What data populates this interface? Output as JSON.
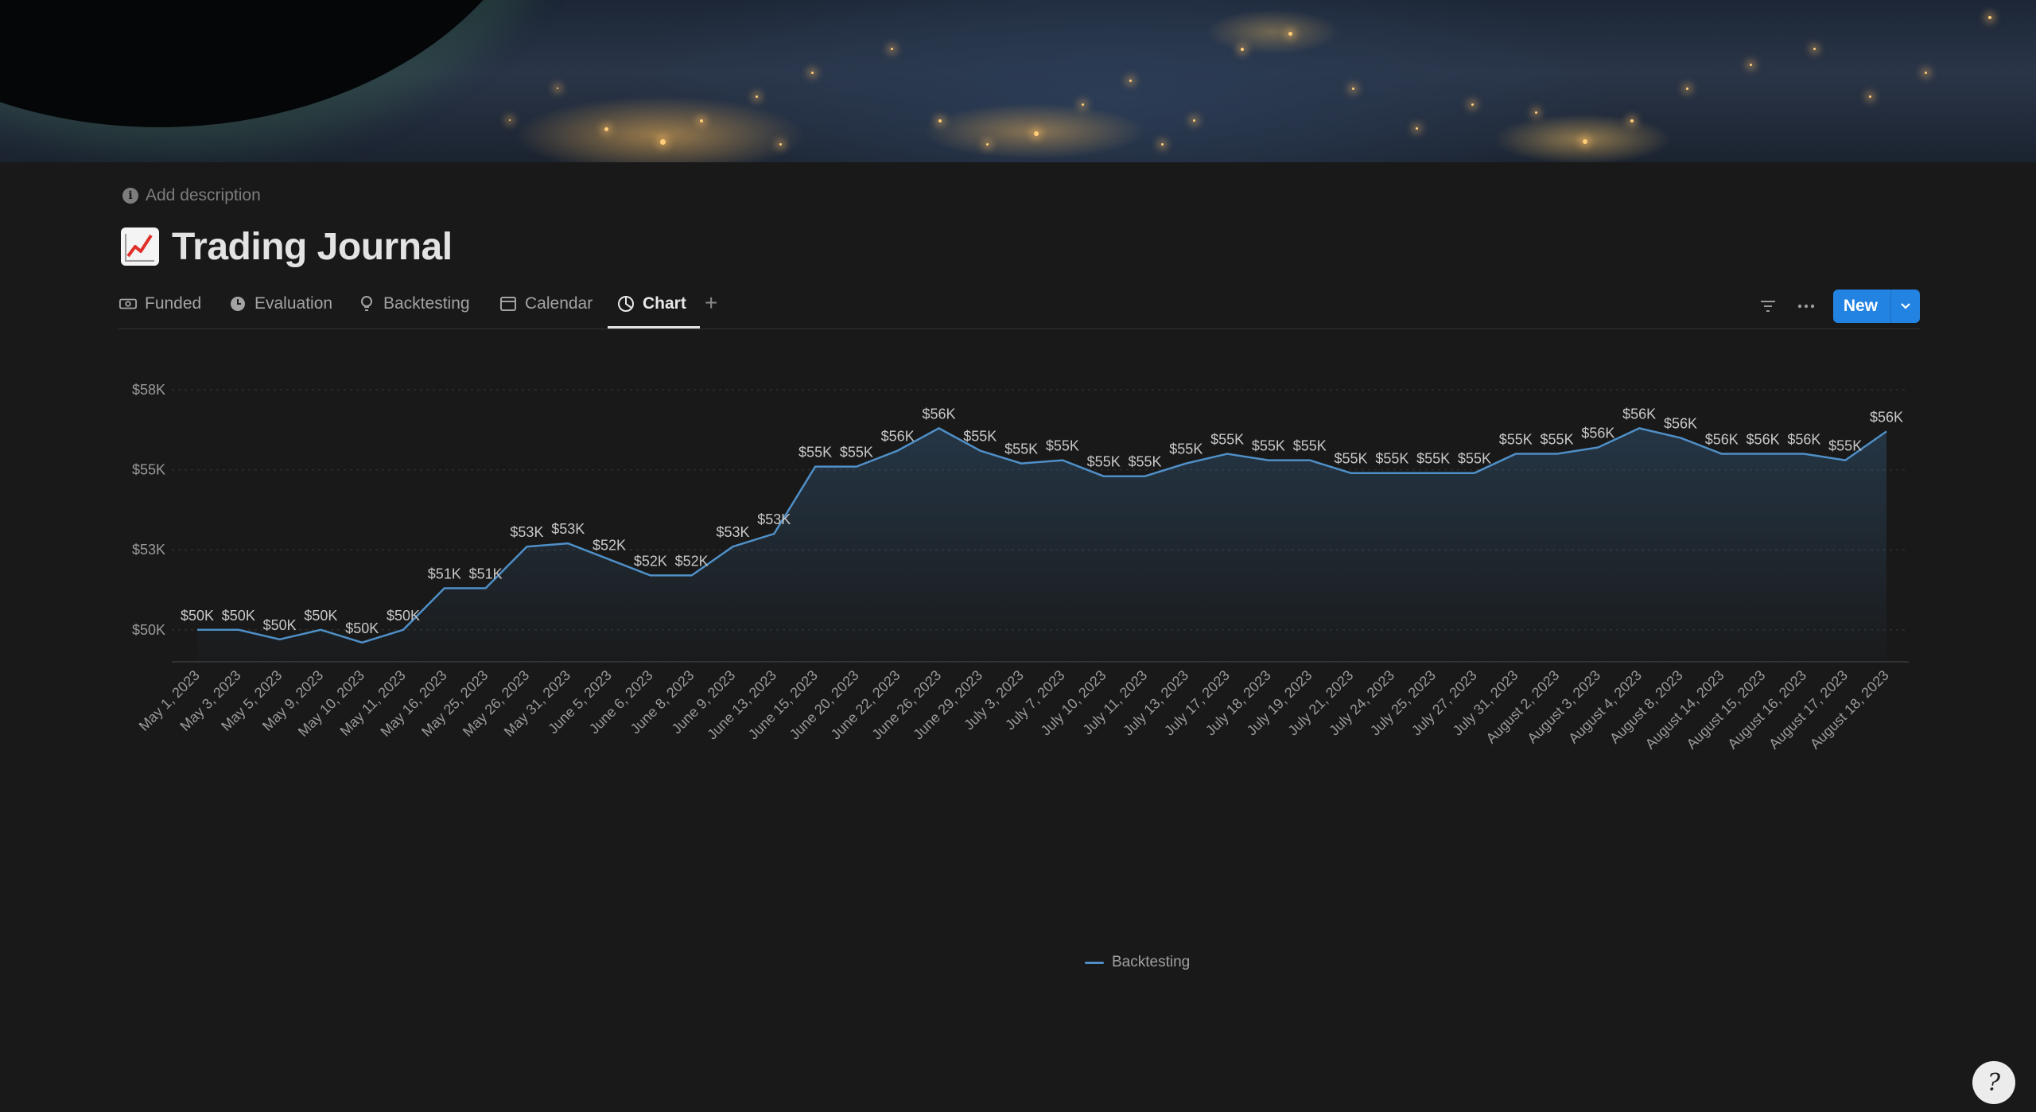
{
  "page": {
    "add_description": "Add description",
    "title": "Trading Journal",
    "title_icon": "chart-increasing-emoji"
  },
  "tabs": [
    {
      "label": "Funded",
      "icon": "money-icon"
    },
    {
      "label": "Evaluation",
      "icon": "clock-icon"
    },
    {
      "label": "Backtesting",
      "icon": "lightbulb-icon"
    },
    {
      "label": "Calendar",
      "icon": "calendar-icon"
    },
    {
      "label": "Chart",
      "icon": "chart-icon",
      "active": true
    }
  ],
  "toolbar": {
    "add_tab": "+",
    "new_label": "New"
  },
  "colors": {
    "background": "#191919",
    "accent": "#2383e2",
    "series_line": "#4f8fc7"
  },
  "chart_data": {
    "type": "area",
    "x": [
      "May 1, 2023",
      "May 3, 2023",
      "May 5, 2023",
      "May 9, 2023",
      "May 10, 2023",
      "May 11, 2023",
      "May 16, 2023",
      "May 25, 2023",
      "May 26, 2023",
      "May 31, 2023",
      "June 5, 2023",
      "June 6, 2023",
      "June 8, 2023",
      "June 9, 2023",
      "June 13, 2023",
      "June 15, 2023",
      "June 20, 2023",
      "June 22, 2023",
      "June 26, 2023",
      "June 29, 2023",
      "July 3, 2023",
      "July 7, 2023",
      "July 10, 2023",
      "July 11, 2023",
      "July 13, 2023",
      "July 17, 2023",
      "July 18, 2023",
      "July 19, 2023",
      "July 21, 2023",
      "July 24, 2023",
      "July 25, 2023",
      "July 27, 2023",
      "July 31, 2023",
      "August 2, 2023",
      "August 3, 2023",
      "August 4, 2023",
      "August 8, 2023",
      "August 14, 2023",
      "August 15, 2023",
      "August 16, 2023",
      "August 17, 2023",
      "August 18, 2023"
    ],
    "series": [
      {
        "name": "Backtesting",
        "values": [
          50000,
          50000,
          49700,
          50000,
          49600,
          50000,
          51300,
          51300,
          52600,
          52700,
          52200,
          51700,
          51700,
          52600,
          53000,
          55100,
          55100,
          55600,
          56300,
          55600,
          55200,
          55300,
          54800,
          54800,
          55200,
          55500,
          55300,
          55300,
          54900,
          54900,
          54900,
          54900,
          55500,
          55500,
          55700,
          56300,
          56000,
          55500,
          55500,
          55500,
          55300,
          56200
        ],
        "labels": [
          "$50K",
          "$50K",
          "$50K",
          "$50K",
          "$50K",
          "$50K",
          "$51K",
          "$51K",
          "$53K",
          "$53K",
          "$52K",
          "$52K",
          "$52K",
          "$53K",
          "$53K",
          "$55K",
          "$55K",
          "$56K",
          "$56K",
          "$55K",
          "$55K",
          "$55K",
          "$55K",
          "$55K",
          "$55K",
          "$55K",
          "$55K",
          "$55K",
          "$55K",
          "$55K",
          "$55K",
          "$55K",
          "$55K",
          "$55K",
          "$56K",
          "$56K",
          "$56K",
          "$56K",
          "$56K",
          "$56K",
          "$55K",
          "$56K"
        ]
      }
    ],
    "y_ticks": [
      {
        "value": 50000,
        "label": "$50K"
      },
      {
        "value": 52500,
        "label": "$53K"
      },
      {
        "value": 55000,
        "label": "$55K"
      },
      {
        "value": 57500,
        "label": "$58K"
      }
    ],
    "ylim": [
      49000,
      58000
    ],
    "grid": true,
    "legend": "bottom-center"
  }
}
